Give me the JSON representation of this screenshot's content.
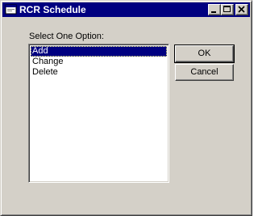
{
  "window": {
    "title": "RCR Schedule"
  },
  "icons": {
    "app": "app-window-icon",
    "minimize": "minimize-icon",
    "maximize": "maximize-icon",
    "close": "close-icon"
  },
  "dialog": {
    "prompt": "Select One Option:",
    "options": [
      "Add",
      "Change",
      "Delete"
    ],
    "selected_option": "Add",
    "ok_label": "OK",
    "cancel_label": "Cancel"
  },
  "colors": {
    "title_bar": "#000080",
    "face": "#d4d0c8",
    "selection": "#000080"
  }
}
